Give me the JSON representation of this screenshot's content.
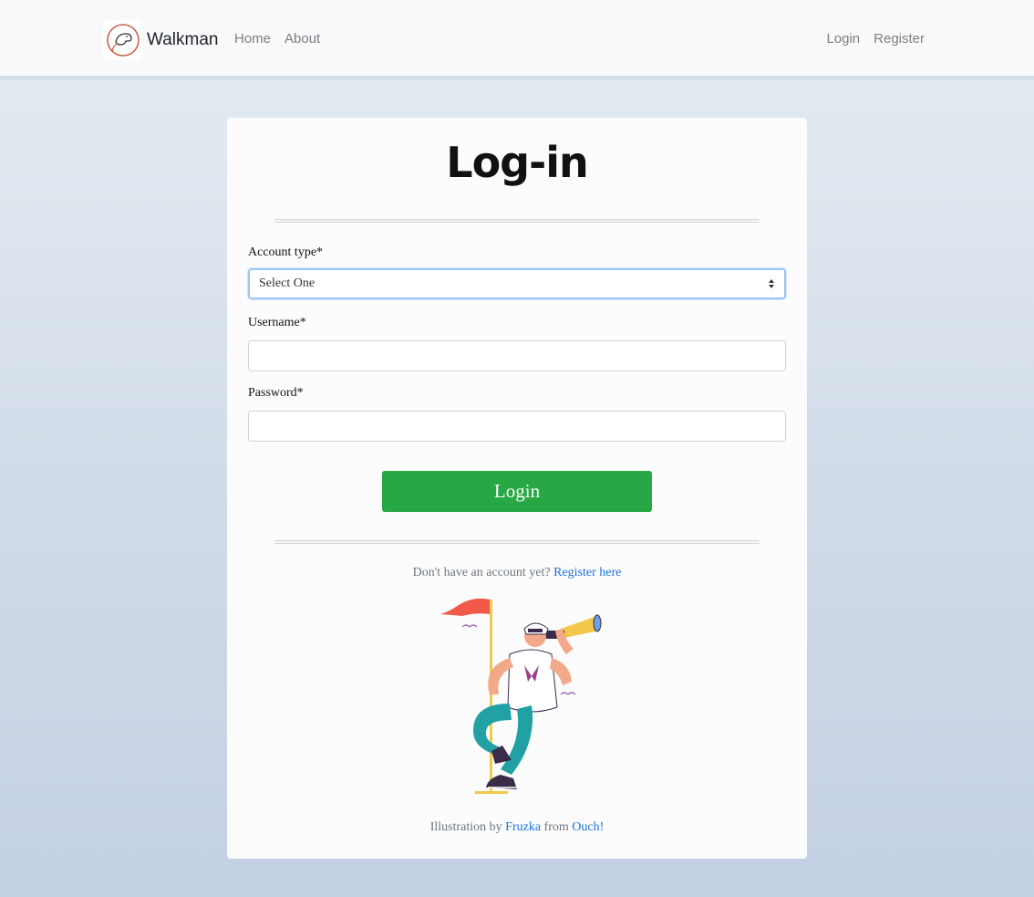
{
  "navbar": {
    "brand": "Walkman",
    "links_left": [
      "Home",
      "About"
    ],
    "links_right": [
      "Login",
      "Register"
    ]
  },
  "form": {
    "title": "Log-in",
    "account_type_label": "Account type*",
    "account_type_value": "Select One",
    "username_label": "Username*",
    "username_value": "",
    "password_label": "Password*",
    "password_value": "",
    "submit_label": "Login"
  },
  "footer": {
    "register_prompt": "Don't have an account yet?",
    "register_link": "Register here",
    "credit_prefix": "Illustration by",
    "credit_author": "Fruzka",
    "credit_mid": "from",
    "credit_source": "Ouch!"
  },
  "colors": {
    "primary_button": "#28a745",
    "link": "#1a73d9",
    "focus_border": "#9cc6f4"
  },
  "icons": [
    "dog-logo-icon",
    "select-caret-icon",
    "sailor-illustration"
  ]
}
